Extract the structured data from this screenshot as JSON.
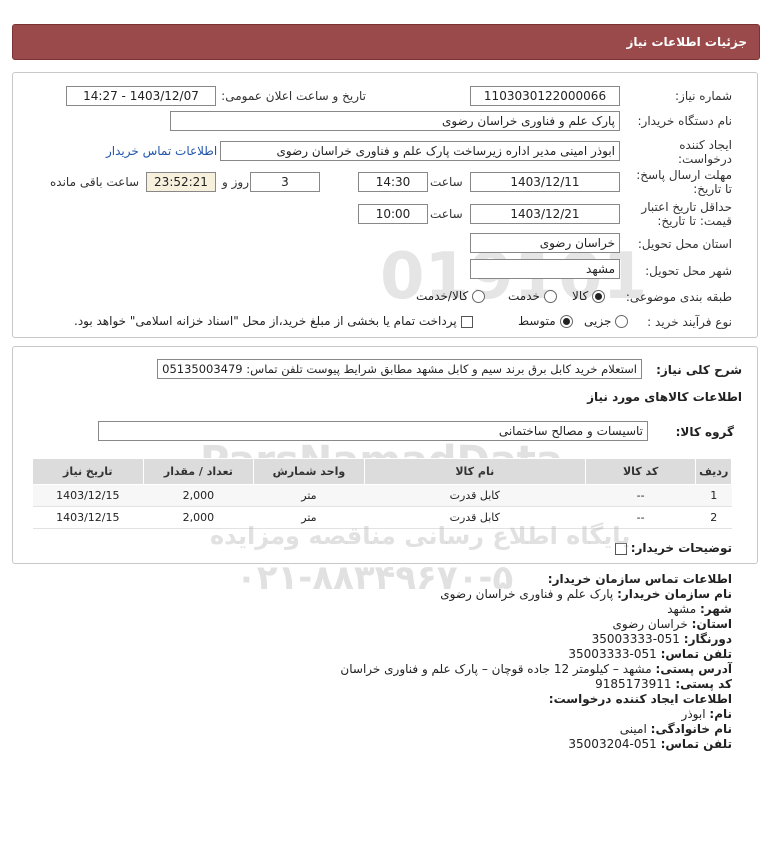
{
  "header": {
    "title": "جزئیات اطلاعات نیاز"
  },
  "form": {
    "need_number_label": "شماره نیاز:",
    "need_number": "1103030122000066",
    "announce_label": "تاریخ و ساعت اعلان عمومی:",
    "announce_value": "1403/12/07 - 14:27",
    "buyer_label": "نام دستگاه خریدار:",
    "buyer_value": "پارک علم و فناوری خراسان رضوی",
    "creator_label_1": "ایجاد کننده",
    "creator_label_2": "درخواست:",
    "creator_value": "ابوذر امینی مدیر اداره زیرساخت پارک علم و فناوری خراسان رضوی",
    "contact_link": "اطلاعات تماس خریدار",
    "deadline_label_1": "مهلت ارسال پاسخ:",
    "deadline_label_2": "تا تاریخ:",
    "deadline_date": "1403/12/11",
    "time_word": "ساعت",
    "deadline_time": "14:30",
    "days_value": "3",
    "days_word": "روز و",
    "remaining_time": "23:52:21",
    "remaining_word": "ساعت باقی مانده",
    "validity_label_1": "حداقل تاریخ اعتبار",
    "validity_label_2": "قیمت: تا تاریخ:",
    "validity_date": "1403/12/21",
    "validity_time": "10:00",
    "province_label": "استان محل تحویل:",
    "province_value": "خراسان رضوی",
    "city_label": "شهر محل تحویل:",
    "city_value": "مشهد",
    "category_label": "طبقه بندی موضوعی:",
    "category_options": [
      "کالا",
      "خدمت",
      "کالا/خدمت"
    ],
    "process_label": "نوع فرآیند خرید :",
    "process_options": [
      "جزیی",
      "متوسط"
    ],
    "payment_note": "پرداخت تمام یا بخشی از مبلغ خرید،از محل \"اسناد خزانه اسلامی\" خواهد بود."
  },
  "summary": {
    "desc_label": "شرح کلی نیاز:",
    "desc_value": "استعلام خرید کابل برق برند سیم و کابل مشهد مطابق شرایط پیوست تلفن تماس: 05135003479",
    "goods_info_title": "اطلاعات کالاهای مورد نیاز",
    "group_label": "گروه کالا:",
    "group_value": "تاسیسات و مصالح ساختمانی"
  },
  "table": {
    "headers": [
      "ردیف",
      "کد کالا",
      "نام کالا",
      "واحد شمارش",
      "تعداد / مقدار",
      "تاریخ نیاز"
    ],
    "rows": [
      [
        "1",
        "--",
        "کابل قدرت",
        "متر",
        "2,000",
        "1403/12/15"
      ],
      [
        "2",
        "--",
        "کابل قدرت",
        "متر",
        "2,000",
        "1403/12/15"
      ]
    ]
  },
  "buyer_notes_label": "توضیحات خریدار:",
  "contact": {
    "title": "اطلاعات تماس سازمان خریدار:",
    "org_label": "نام سازمان خریدار:",
    "org_value": "پارک علم و فناوری خراسان رضوی",
    "city_label": "شهر:",
    "city_value": "مشهد",
    "province_label": "استان:",
    "province_value": "خراسان رضوی",
    "fax_label": "دورنگار:",
    "fax_value": "051-35003333",
    "phone_label": "تلفن تماس:",
    "phone_value": "051-35003333",
    "address_label": "آدرس پستی:",
    "address_value": "مشهد – کیلومتر 12 جاده قوچان – پارک علم و فناوری خراسان",
    "postal_label": "کد پستی:",
    "postal_value": "9185173911",
    "creator_title": "اطلاعات ایجاد کننده درخواست:",
    "name_label": "نام:",
    "name_value": "ابوذر",
    "family_label": "نام خانوادگی:",
    "family_value": "امینی",
    "creator_phone_label": "تلفن تماس:",
    "creator_phone_value": "051-35003204"
  },
  "watermark": {
    "line1": "ParsNamadData",
    "line2": "مرکز فراوری اطلاعات پارس نماد داده ها",
    "line3": "پایگاه اطلاع رسانی مناقصه ومزایده",
    "line4": "۰۲۱-۸۸۳۴۹۶۷۰-۵",
    "line5": "019101"
  }
}
